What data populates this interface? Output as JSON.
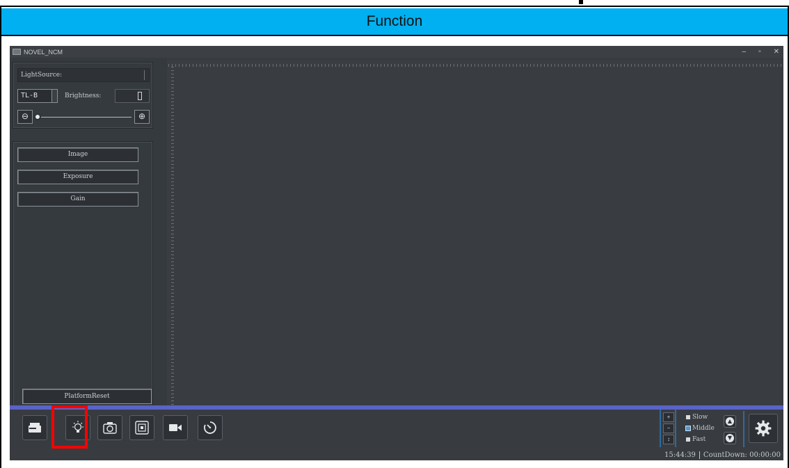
{
  "section_header": "Function",
  "window": {
    "title": "NOVEL_NCM",
    "controls": [
      "–",
      "▫",
      "✕"
    ]
  },
  "light_source": {
    "label": "LightSource:",
    "source_value": "TL-B",
    "brightness_label": "Brightness:"
  },
  "camera_buttons": [
    "Image",
    "Exposure",
    "Gain"
  ],
  "platform_reset": "PlatformReset",
  "toolbar": {
    "buttons": [
      "stage-icon",
      "light-bulb-icon",
      "camera-icon",
      "autofocus-icon",
      "video-camera-icon",
      "timer-icon"
    ],
    "highlighted": "light-bulb-icon"
  },
  "speed": {
    "options": [
      "Slow",
      "Middle",
      "Fast"
    ],
    "selected": "Middle"
  },
  "status": {
    "time": "15:44:39",
    "countdown": "CountDown: 00:00:00"
  },
  "colors": {
    "header_bg": "#00b0f0",
    "accent_bar": "#5a63c8",
    "highlight": "#ff0000",
    "app_bg": "#383c41"
  }
}
